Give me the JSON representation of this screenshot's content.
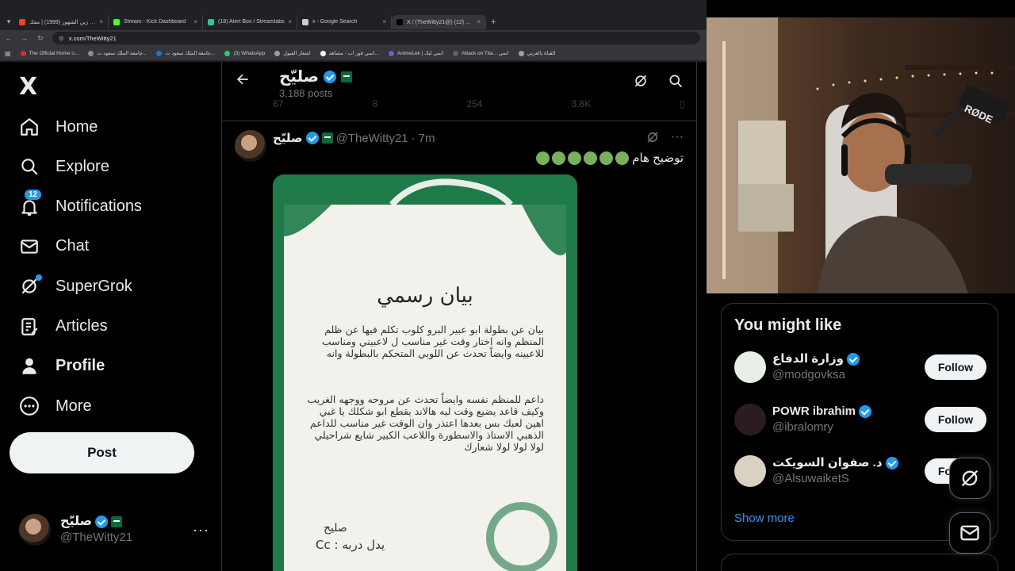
{
  "browser": {
    "tabs": [
      {
        "title": "رمضان زين الشهور (1999) | مفك...",
        "fav": "#ff3b30",
        "active": false
      },
      {
        "title": "Stream - Kick Dashboard",
        "fav": "#53fc18",
        "active": false
      },
      {
        "title": "(18) Alert Box / Streamlabs",
        "fav": "#31c3a2",
        "active": false
      },
      {
        "title": "x - Google Search",
        "fav": "#cccccc",
        "active": false
      },
      {
        "title": "X / (TheWitty21@) صليّح (12)",
        "fav": "#000000",
        "active": true
      }
    ],
    "url": "x.com/TheWitty21",
    "bookmarks": [
      {
        "label": "The Official Home o...",
        "dot": "#d32f2f"
      },
      {
        "label": "جامعة الملك سعود ت...",
        "dot": "#8e8e8e"
      },
      {
        "label": "جامعة الملك سعود ت...",
        "dot": "#1976d2"
      },
      {
        "label": "(3) WhatsApp",
        "dot": "#25d366"
      },
      {
        "label": "اشعار الفيول",
        "dot": "#9e9e9e"
      },
      {
        "label": "انمي فور اب - مشاهد...",
        "dot": "#ffffff"
      },
      {
        "label": "AnimeLek | انمي ليك",
        "dot": "#7e57c2"
      },
      {
        "label": "Attack on Tita... انمي",
        "dot": "#616161"
      },
      {
        "label": "القناة بالعربي",
        "dot": "#9e9e9e"
      }
    ]
  },
  "nav": {
    "logo": "X",
    "items": [
      {
        "key": "home",
        "label": "Home",
        "icon": "home-icon",
        "bold": false
      },
      {
        "key": "explore",
        "label": "Explore",
        "icon": "search-icon",
        "bold": false
      },
      {
        "key": "notifications",
        "label": "Notifications",
        "icon": "bell-icon",
        "bold": false,
        "badge": "12"
      },
      {
        "key": "chat",
        "label": "Chat",
        "icon": "mail-icon",
        "bold": false
      },
      {
        "key": "supergrok",
        "label": "SuperGrok",
        "icon": "grok-icon",
        "bold": false
      },
      {
        "key": "articles",
        "label": "Articles",
        "icon": "article-icon",
        "bold": false
      },
      {
        "key": "profile",
        "label": "Profile",
        "icon": "person-icon",
        "bold": true
      },
      {
        "key": "more",
        "label": "More",
        "icon": "more-circle-icon",
        "bold": false
      }
    ],
    "post_label": "Post",
    "account": {
      "name": "صليّح",
      "handle": "@TheWitty21",
      "more": "···"
    }
  },
  "profile_header": {
    "name": "صليّح",
    "posts": "3,188 posts",
    "stats": [
      "67",
      "8",
      "254",
      "3.8K"
    ]
  },
  "tweet": {
    "name": "صليّح",
    "handle": "@TheWitty21",
    "dot": "·",
    "time": "7m",
    "text": "توضيح هام",
    "circles": 6,
    "image": {
      "title": "بيان رسمي",
      "para1": "بيان عن بطولة ابو عبير البرو كلوب تكلم فيها عن ظلم المنظم وانه اختار وقت غير مناسب ل لاعبيني ومناسب للاعبينه وايضاً تحدث عن اللوبي المتحكم بالبطولة وانه",
      "para2": "داعم للمنظم نفسه وايضاً تحدث عن مروحه ووجهه الغريب وكيف قاعد يضيع وقت ليه هالاند يقطع ابو شكلك يا غبي اهين لعبك بس بعدها اعتذر وان الوقت غير مناسب للداعم الذهبي الاستاذ والاسطورة واللاعب الكبير شايع شراحيلي لولا لولا لولا شعارك",
      "sign": "صليح",
      "cc": "Cc : يدل دربه"
    }
  },
  "you_might_like": {
    "title": "You might like",
    "suggestions": [
      {
        "name": "وزارة الدفاع",
        "handle": "@modgovksa",
        "follow": "Follow",
        "avatar": "#e8efe8"
      },
      {
        "name": "POWR ibrahim",
        "handle": "@ibralomry",
        "follow": "Follow",
        "avatar": "#2b1c22"
      },
      {
        "name": "د. صفوان السويكت",
        "handle": "@AlsuwaiketS",
        "follow": "Follow",
        "avatar": "#d9d2c2"
      }
    ],
    "show_more": "Show more"
  },
  "colors": {
    "accent": "#1d9bf0",
    "bg": "#000000",
    "border": "#2f3336",
    "muted": "#71767b",
    "green": "#1e7a48"
  }
}
